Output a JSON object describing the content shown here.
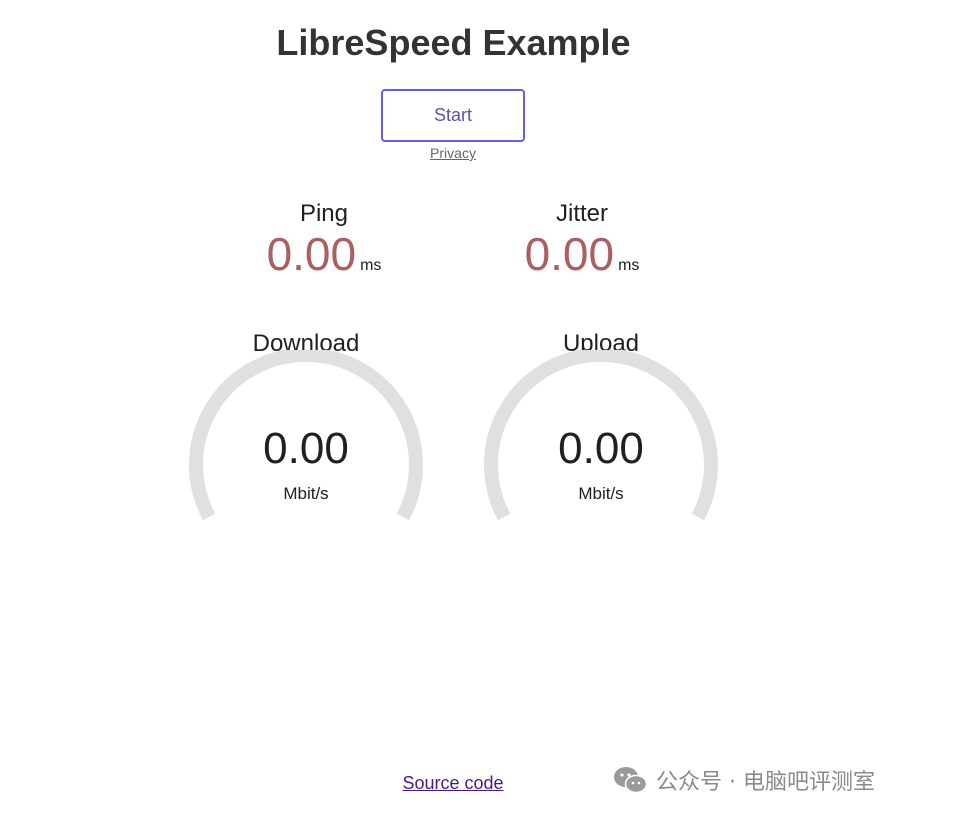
{
  "header": {
    "title": "LibreSpeed Example"
  },
  "controls": {
    "start_label": "Start",
    "privacy_label": "Privacy"
  },
  "ping": {
    "label": "Ping",
    "value": "0.00",
    "unit": "ms"
  },
  "jitter": {
    "label": "Jitter",
    "value": "0.00",
    "unit": "ms"
  },
  "download": {
    "label": "Download",
    "value": "0.00",
    "unit": "Mbit/s"
  },
  "upload": {
    "label": "Upload",
    "value": "0.00",
    "unit": "Mbit/s"
  },
  "footer": {
    "source_label": "Source code"
  },
  "watermark": {
    "text": "公众号 · 电脑吧评测室",
    "icon": "wechat-icon"
  },
  "colors": {
    "accent_button_border": "#6060e0",
    "button_text": "#5a52a8",
    "metric_value": "#aa6060",
    "gauge_track": "#e0e0e0",
    "source_link": "#4a1a8a"
  }
}
